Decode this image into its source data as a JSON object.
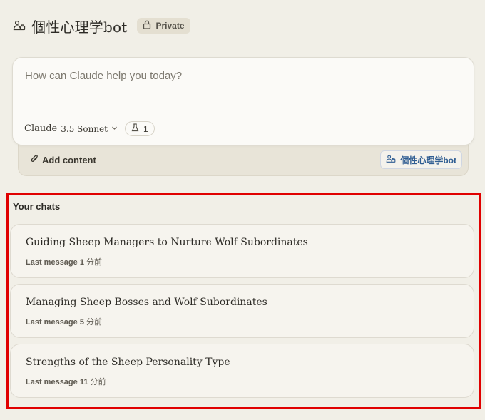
{
  "header": {
    "title": "個性心理学bot",
    "project_icon": "project-people-icon",
    "badge": {
      "label": "Private",
      "icon": "lock-icon"
    }
  },
  "composer": {
    "placeholder": "How can Claude help you today?",
    "model": {
      "name": "Claude",
      "version": "3.5 Sonnet",
      "icon": "chevron-down-icon"
    },
    "style_chip": {
      "icon": "flask-icon",
      "count": "1"
    }
  },
  "attach_bar": {
    "add_content_label": "Add content",
    "add_content_icon": "paperclip-icon",
    "project_chip_label": "個性心理学bot",
    "project_chip_icon": "project-people-icon"
  },
  "chats": {
    "heading": "Your chats",
    "items": [
      {
        "title": "Guiding Sheep Managers to Nurture Wolf Subordinates",
        "meta_label": "Last message",
        "meta_num": "1",
        "meta_unit": "分前"
      },
      {
        "title": "Managing Sheep Bosses and Wolf Subordinates",
        "meta_label": "Last message",
        "meta_num": "5",
        "meta_unit": "分前"
      },
      {
        "title": "Strengths of the Sheep Personality Type",
        "meta_label": "Last message",
        "meta_num": "11",
        "meta_unit": "分前"
      }
    ]
  },
  "colors": {
    "background": "#f1efe7",
    "highlight_border": "#e00000",
    "project_chip_text": "#2f5d92",
    "badge_bg": "#e4dfd1"
  }
}
